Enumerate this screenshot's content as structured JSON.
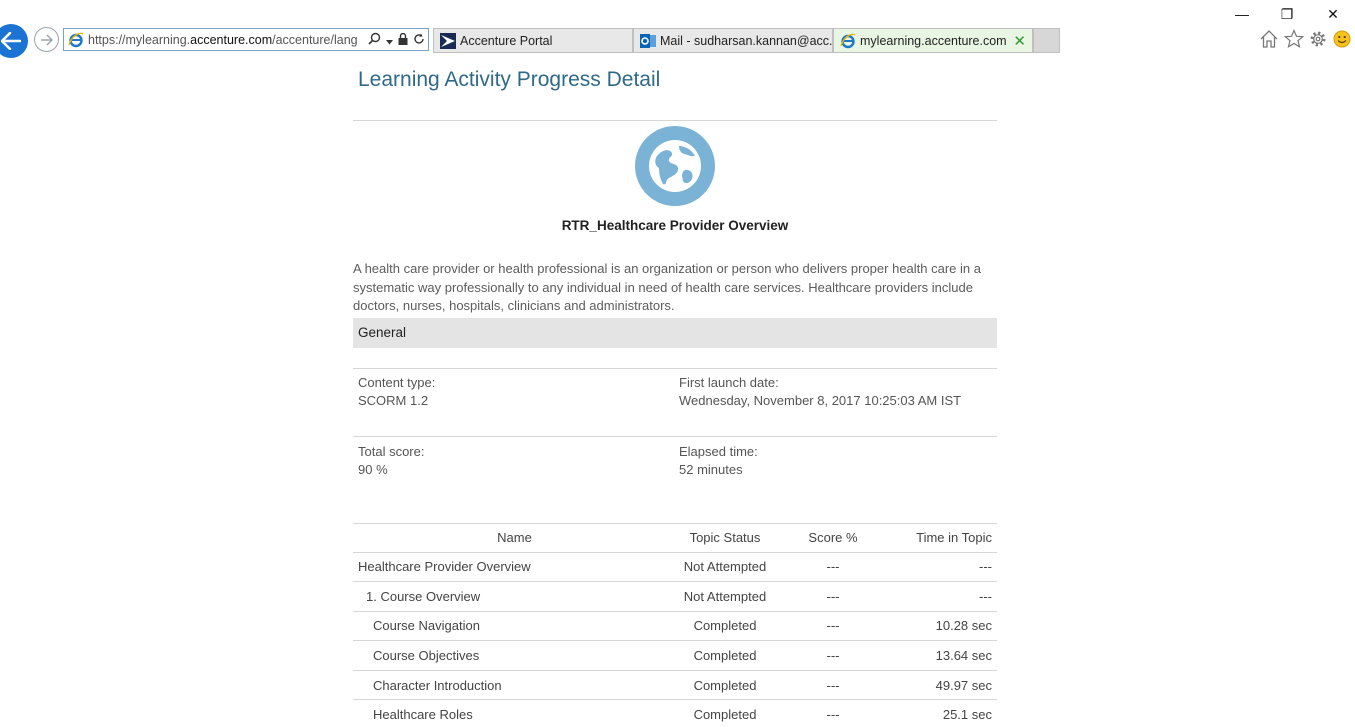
{
  "browser": {
    "url_prefix": "https://mylearning.",
    "url_domain": "accenture.com",
    "url_rest": "/accenture/lang",
    "tabs": [
      {
        "label": "Accenture Portal",
        "icon": "accenture-icon"
      },
      {
        "label": "Mail - sudharsan.kannan@acc...",
        "icon": "outlook-icon"
      },
      {
        "label": "mylearning.accenture.com",
        "icon": "ie-icon",
        "active": true
      }
    ],
    "window_controls": {
      "minimize": "—",
      "restore": "❐",
      "close": "✕"
    },
    "tab_close": "✕"
  },
  "page": {
    "title": "Learning Activity Progress Detail",
    "course_name": "RTR_Healthcare Provider Overview",
    "description": "A health care provider or health professional is an organization or person who delivers proper health care in a systematic way professionally to any individual in need of health care services. Healthcare providers include doctors, nurses, hospitals, clinicians and administrators.",
    "general": {
      "heading": "General",
      "content_type_label": "Content type:",
      "content_type_value": "SCORM 1.2",
      "first_launch_label": "First launch date:",
      "first_launch_value": "Wednesday, November 8, 2017 10:25:03 AM IST",
      "total_score_label": "Total score:",
      "total_score_value": "90 %",
      "elapsed_label": "Elapsed time:",
      "elapsed_value": "52 minutes"
    },
    "table": {
      "headers": {
        "name": "Name",
        "status": "Topic Status",
        "score": "Score %",
        "time": "Time in Topic"
      },
      "rows": [
        {
          "name": "Healthcare Provider Overview",
          "status": "Not Attempted",
          "score": "---",
          "time": "---",
          "indent": 0
        },
        {
          "name": "1. Course Overview",
          "status": "Not Attempted",
          "score": "---",
          "time": "---",
          "indent": 1
        },
        {
          "name": "Course Navigation",
          "status": "Completed",
          "score": "---",
          "time": "10.28 sec",
          "indent": 2
        },
        {
          "name": "Course Objectives",
          "status": "Completed",
          "score": "---",
          "time": "13.64 sec",
          "indent": 2
        },
        {
          "name": "Character Introduction",
          "status": "Completed",
          "score": "---",
          "time": "49.97 sec",
          "indent": 2
        },
        {
          "name": "Healthcare Roles",
          "status": "Completed",
          "score": "---",
          "time": "25.1 sec",
          "indent": 2
        }
      ]
    }
  }
}
